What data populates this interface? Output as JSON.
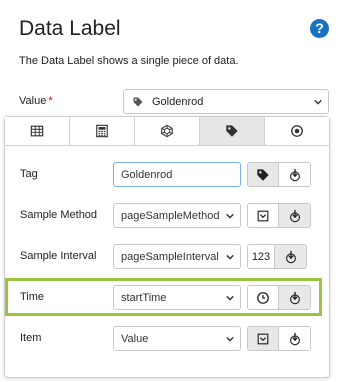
{
  "header": {
    "title": "Data Label",
    "help_glyph": "?",
    "description": "The Data Label shows a single piece of data."
  },
  "value": {
    "label": "Value",
    "required_mark": "*",
    "selected": "Goldenrod"
  },
  "tabs": [
    {
      "icon": "table-icon"
    },
    {
      "icon": "calculator-icon"
    },
    {
      "icon": "network-icon"
    },
    {
      "icon": "tag-icon",
      "active": true
    },
    {
      "icon": "radio-target-icon"
    }
  ],
  "rows": {
    "tag": {
      "label": "Tag",
      "value": "Goldenrod"
    },
    "sample_method": {
      "label": "Sample Method",
      "value": "pageSampleMethod"
    },
    "sample_interval": {
      "label": "Sample Interval",
      "value": "pageSampleInterval",
      "button_text": "123"
    },
    "time": {
      "label": "Time",
      "value": "startTime"
    },
    "item": {
      "label": "Item",
      "value": "Value"
    }
  },
  "colors": {
    "highlight": "#9bc440",
    "help": "#1a73c2",
    "required": "#d0021b"
  }
}
